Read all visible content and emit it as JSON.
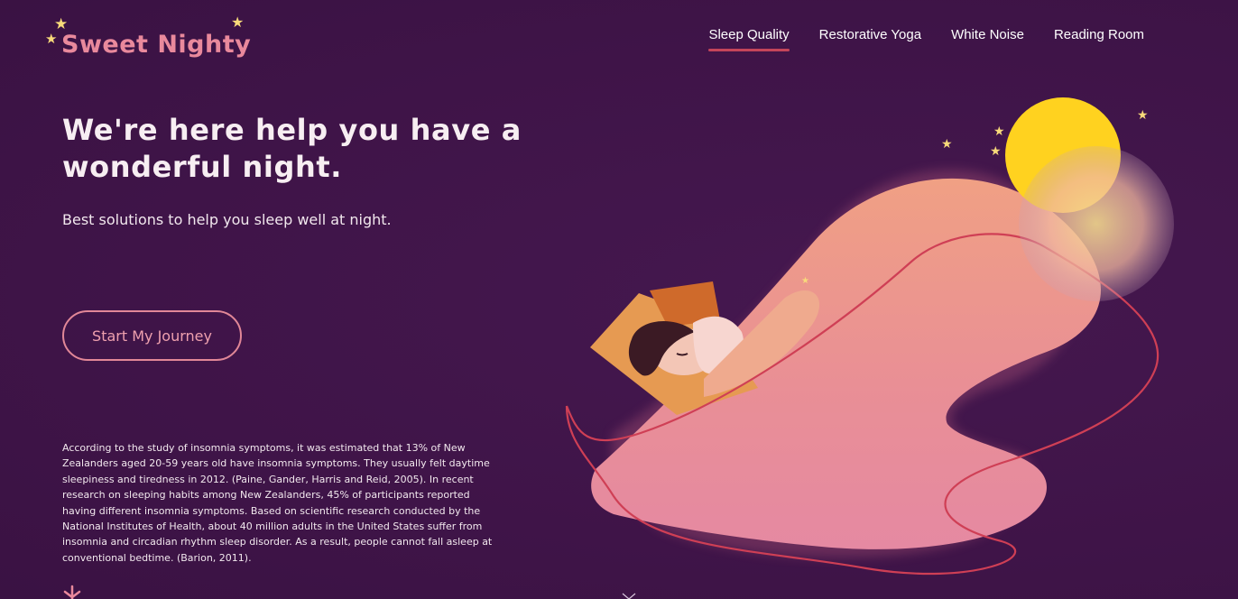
{
  "brand": {
    "logo_text": "Sweet Nighty",
    "accent_color": "#e9899c",
    "star_color": "#f8da7a"
  },
  "nav": {
    "items": [
      {
        "label": "Sleep Quality",
        "active": true
      },
      {
        "label": "Restorative Yoga",
        "active": false
      },
      {
        "label": "White Noise",
        "active": false
      },
      {
        "label": "Reading Room",
        "active": false
      }
    ]
  },
  "hero": {
    "title": "We're here help you have a wonderful night.",
    "subtitle": "Best solutions to help you sleep well at night.",
    "cta_label": "Start My Journey"
  },
  "article": {
    "text": "According to the study of insomnia symptoms, it was estimated that 13% of New Zealanders aged 20-59 years old have insomnia symptoms. They usually felt daytime sleepiness and tiredness in 2012. (Paine, Gander, Harris and Reid, 2005). In recent research on sleeping habits among New Zealanders, 45% of participants reported having different insomnia symptoms. Based on scientific research conducted by the National Institutes of Health, about 40 million adults in the United States suffer from insomnia and circadian rhythm sleep disorder. As a result, people cannot fall asleep at conventional bedtime. (Barion, 2011)."
  },
  "icons": {
    "star": "star-icon",
    "moon": "moon-icon",
    "sleeping_woman": "sleeping-woman-illustration"
  }
}
